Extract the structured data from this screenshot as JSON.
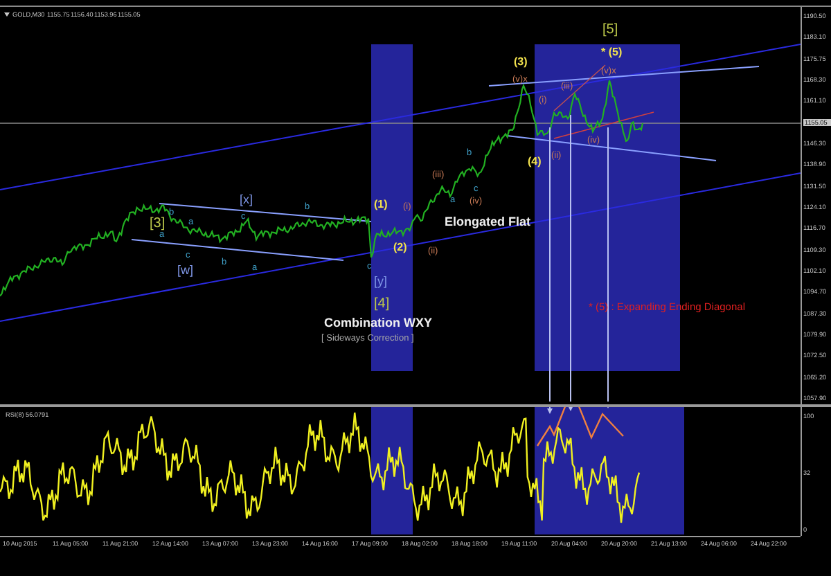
{
  "chart": {
    "symbol": "GOLD,M30",
    "quotes": [
      "1155.75",
      "1156.40",
      "1153.96",
      "1155.05"
    ],
    "wave_labels": [
      {
        "text": "[3]",
        "kind": "primary"
      },
      {
        "text": "[x]",
        "kind": "combo"
      },
      {
        "text": "[w]",
        "kind": "combo"
      },
      {
        "text": "(1)",
        "kind": "intermediate"
      },
      {
        "text": "(2)",
        "kind": "intermediate"
      },
      {
        "text": "[y]",
        "kind": "combo"
      },
      {
        "text": "[4]",
        "kind": "primary"
      },
      {
        "text": "(3)",
        "kind": "intermediate"
      },
      {
        "text": "(4)",
        "kind": "intermediate"
      },
      {
        "text": "[5]",
        "kind": "primary"
      },
      {
        "text": "* (5)",
        "kind": "intermediate"
      },
      {
        "text": "(i)",
        "kind": "minor"
      },
      {
        "text": "(ii)",
        "kind": "minor"
      },
      {
        "text": "(iii)",
        "kind": "minor"
      },
      {
        "text": "(iv)",
        "kind": "minor"
      },
      {
        "text": "(v)x",
        "kind": "minor"
      },
      {
        "text": "(i)",
        "kind": "minor"
      },
      {
        "text": "(ii)",
        "kind": "minor"
      },
      {
        "text": "(iii)",
        "kind": "minor"
      },
      {
        "text": "(iv)",
        "kind": "minor"
      },
      {
        "text": "(v)x",
        "kind": "minor"
      },
      {
        "text": "b",
        "kind": "sub"
      },
      {
        "text": "a",
        "kind": "sub"
      },
      {
        "text": "a",
        "kind": "sub"
      },
      {
        "text": "c",
        "kind": "sub"
      },
      {
        "text": "b",
        "kind": "sub"
      },
      {
        "text": "a",
        "kind": "sub"
      },
      {
        "text": "c",
        "kind": "sub"
      },
      {
        "text": "b",
        "kind": "sub"
      },
      {
        "text": "c",
        "kind": "sub"
      },
      {
        "text": "a",
        "kind": "sub"
      },
      {
        "text": "b",
        "kind": "sub"
      },
      {
        "text": "c",
        "kind": "sub"
      }
    ],
    "notes": [
      {
        "text": "Elongated Flat",
        "kind": "title"
      },
      {
        "text": "Combination WXY",
        "kind": "title"
      },
      {
        "text": "[ Sideways Correction ]",
        "kind": "subtitle"
      },
      {
        "text": "* (5) : Expanding Ending Diagonal",
        "kind": "warning"
      }
    ],
    "price_axis": [
      "1190.50",
      "1183.10",
      "1175.75",
      "1168.30",
      "1161.10",
      "1146.30",
      "1138.90",
      "1131.50",
      "1124.10",
      "1116.70",
      "1109.30",
      "1102.10",
      "1094.70",
      "1087.30",
      "1079.90",
      "1072.50",
      "1065.20",
      "1057.90"
    ],
    "current_price": "1155.05"
  },
  "rsi": {
    "title": "RSI(8) 56.0791",
    "axis": [
      "100",
      "32",
      "0"
    ]
  },
  "time_axis": [
    "10 Aug 2015",
    "11 Aug 05:00",
    "11 Aug 21:00",
    "12 Aug 14:00",
    "13 Aug 07:00",
    "13 Aug 23:00",
    "14 Aug 16:00",
    "17 Aug 09:00",
    "18 Aug 02:00",
    "18 Aug 18:00",
    "19 Aug 11:00",
    "20 Aug 04:00",
    "20 Aug 20:00",
    "21 Aug 13:00",
    "24 Aug 06:00",
    "24 Aug 22:00"
  ]
}
